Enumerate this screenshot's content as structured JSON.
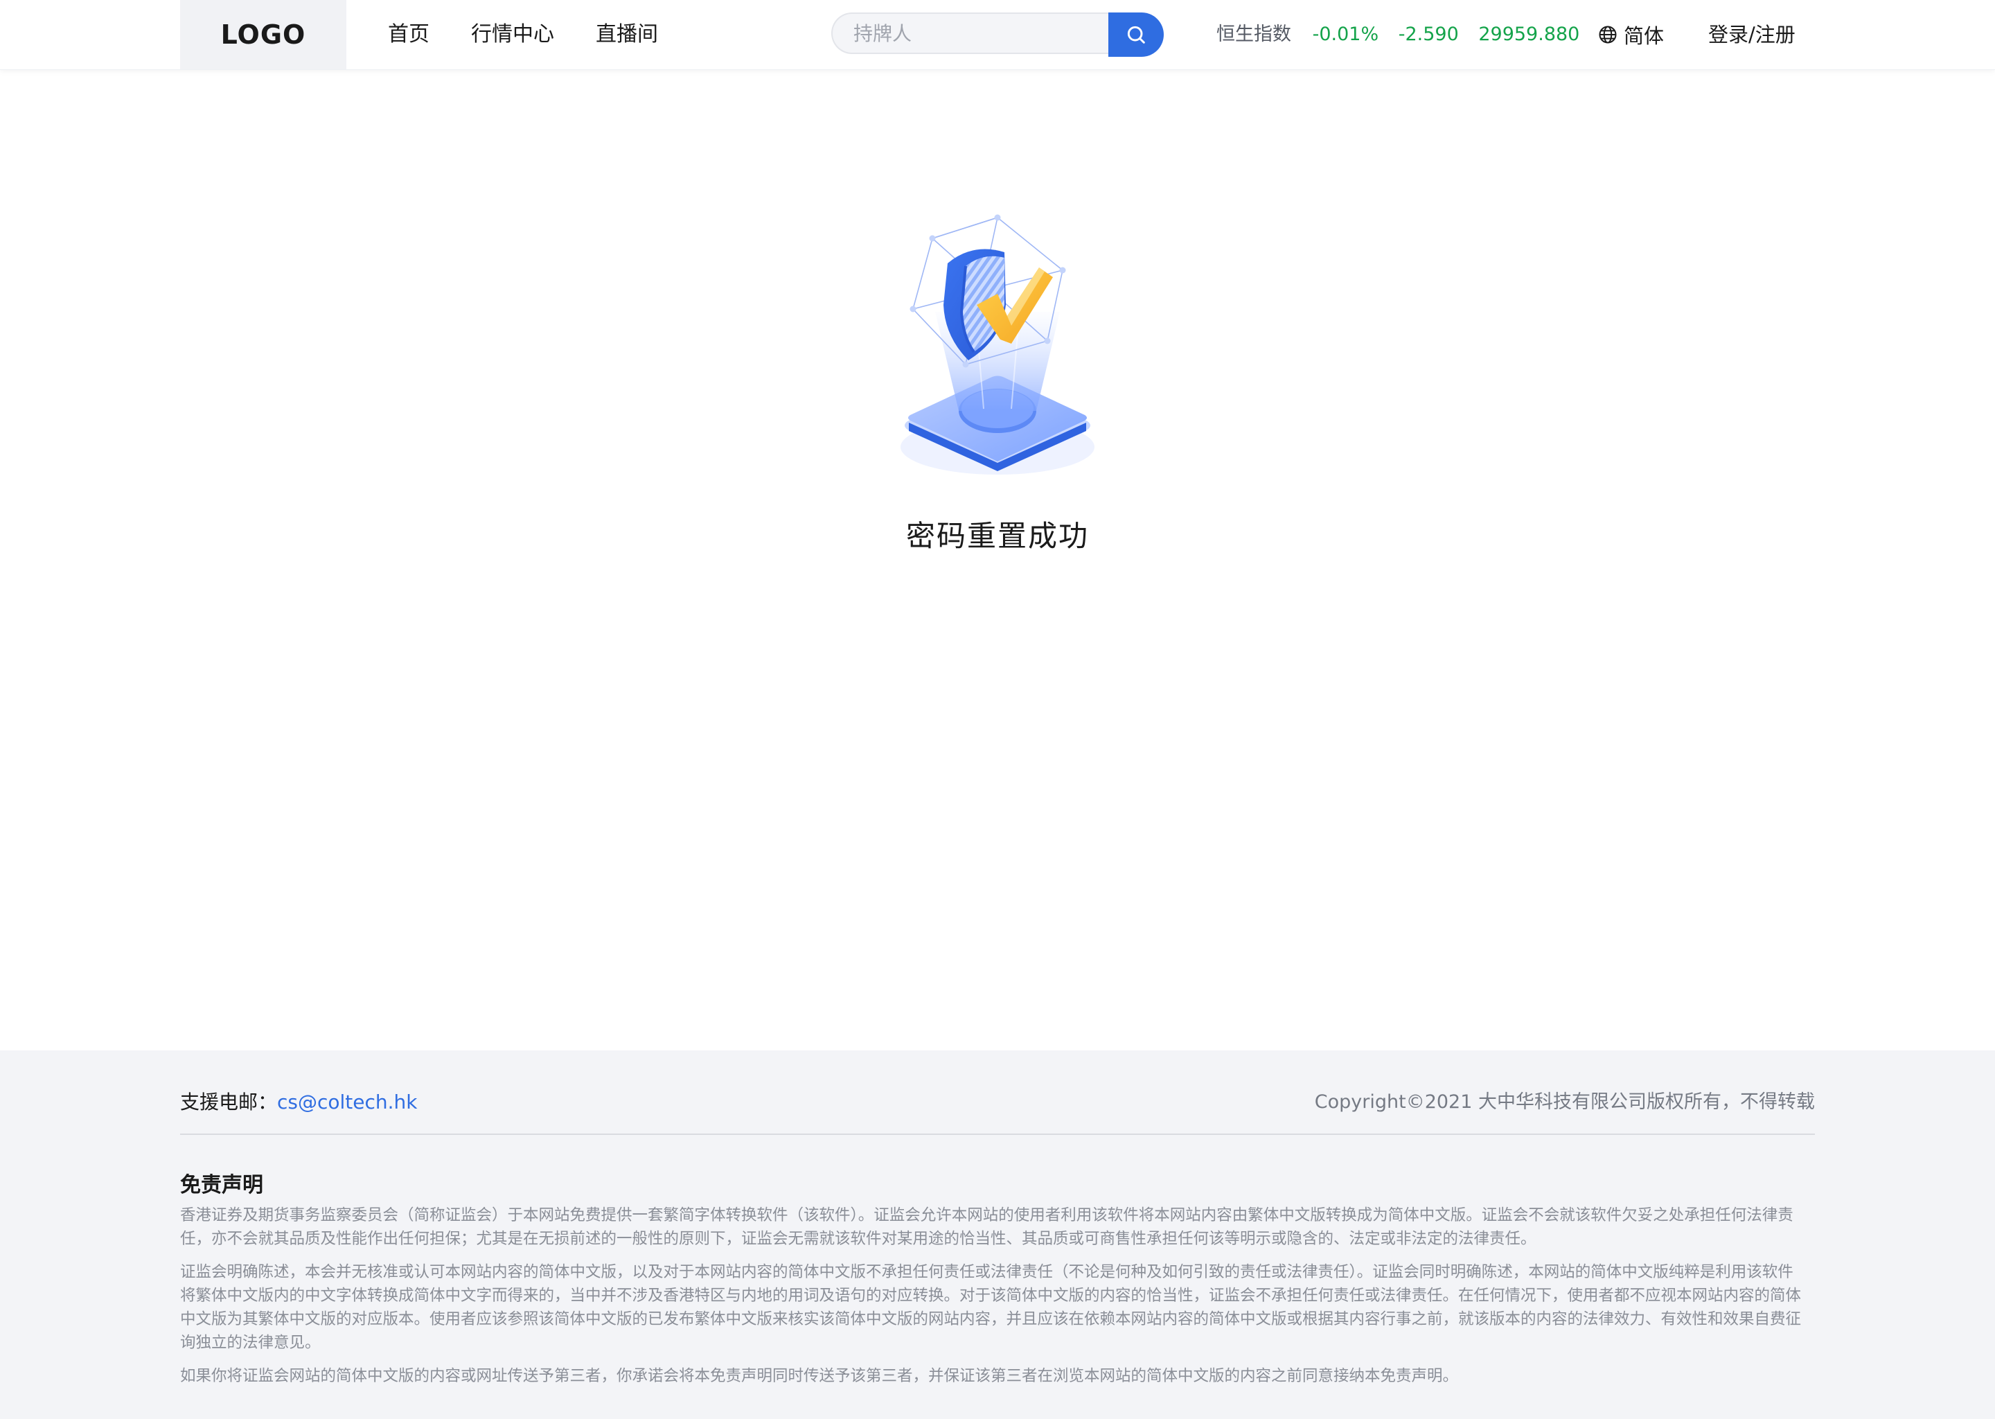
{
  "header": {
    "logo": "LOGO",
    "nav": {
      "home": "首页",
      "market": "行情中心",
      "live": "直播间"
    },
    "search": {
      "placeholder": "持牌人"
    },
    "index": {
      "name": "恒生指数",
      "change_pct": "-0.01%",
      "change": "-2.590",
      "value": "29959.880"
    },
    "language": "简体",
    "login": "登录/注册"
  },
  "main": {
    "title": "密码重置成功"
  },
  "footer": {
    "support_label": "支援电邮：",
    "support_email": "cs@coltech.hk",
    "copyright": "Copyright©2021 大中华科技有限公司版权所有，不得转载",
    "disclaimer_title": "免责声明",
    "disclaimer_paragraphs": [
      "香港证券及期货事务监察委员会（简称证监会）于本网站免费提供一套繁简字体转换软件（该软件）。证监会允许本网站的使用者利用该软件将本网站内容由繁体中文版转换成为简体中文版。证监会不会就该软件欠妥之处承担任何法律责任，亦不会就其品质及性能作出任何担保；尤其是在无损前述的一般性的原则下，证监会无需就该软件对某用途的恰当性、其品质或可商售性承担任何该等明示或隐含的、法定或非法定的法律责任。",
      "证监会明确陈述，本会并无核准或认可本网站内容的简体中文版，以及对于本网站内容的简体中文版不承担任何责任或法律责任（不论是何种及如何引致的责任或法律责任）。证监会同时明确陈述，本网站的简体中文版纯粹是利用该软件将繁体中文版内的中文字体转换成简体中文字而得来的，当中并不涉及香港特区与内地的用词及语句的对应转换。对于该简体中文版的内容的恰当性，证监会不承担任何责任或法律责任。在任何情况下，使用者都不应视本网站内容的简体中文版为其繁体中文版的对应版本。使用者应该参照该简体中文版的已发布繁体中文版来核实该简体中文版的网站内容，并且应该在依赖本网站内容的简体中文版或根据其内容行事之前，就该版本的内容的法律效力、有效性和效果自费征询独立的法律意见。",
      "如果你将证监会网站的简体中文版的内容或网址传送予第三者，你承诺会将本免责声明同时传送予该第三者，并保证该第三者在浏览本网站的简体中文版的内容之前同意接纳本免责声明。"
    ]
  },
  "colors": {
    "accent": "#2f6de1",
    "positive_green": "#14a34a",
    "footer_bg": "#f3f4f7"
  },
  "icons": {
    "search": "search-icon",
    "language": "globe-icon",
    "illustration": "shield-check-illustration"
  }
}
